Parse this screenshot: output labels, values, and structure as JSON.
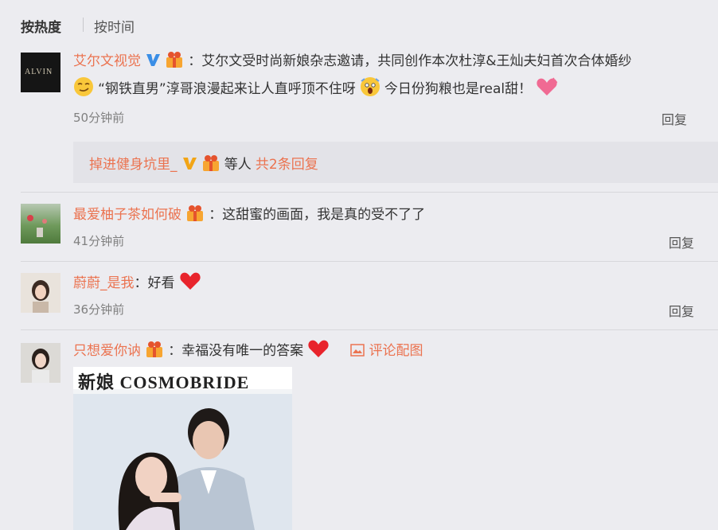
{
  "sort": {
    "hot_label": "按热度",
    "time_label": "按时间"
  },
  "avatar_logo_text": "ALVIN",
  "comments": [
    {
      "user": "艾尔文视觉",
      "text_line1": "：艾尔文受时尚新娘杂志邀请，共同创作本次杜淳&王灿夫妇首次合体婚纱",
      "text_line2": "“钢铁直男”淳哥浪漫起来让人直呼顶不住呀",
      "text_line2b": "今日份狗粮也是real甜！",
      "time": "50分钟前",
      "reply": "回复"
    },
    {
      "user": "最爱柚子茶如何破",
      "text": "：这甜蜜的画面，我是真的受不了了",
      "time": "41分钟前",
      "reply": "回复"
    },
    {
      "user": "蔚蔚_是我",
      "text": "：好看",
      "time": "36分钟前",
      "reply": "回复"
    },
    {
      "user": "只想爱你讷",
      "text": "：幸福没有唯一的答案",
      "pic_label": "评论配图"
    }
  ],
  "sub_reply": {
    "user": "掉进健身坑里_",
    "middle": "等人",
    "count_link": "共2条回复"
  },
  "magazine_text": "新娘 COSMOBRIDE",
  "colors": {
    "username": "#eb7350",
    "reply_box": "#e3e3e8",
    "heart": "#e8242c"
  },
  "icons": [
    "verified-v-icon",
    "gift-badge-icon",
    "smirk-emoji-icon",
    "scream-emoji-icon",
    "pink-heart-icon",
    "red-heart-icon",
    "image-icon"
  ]
}
